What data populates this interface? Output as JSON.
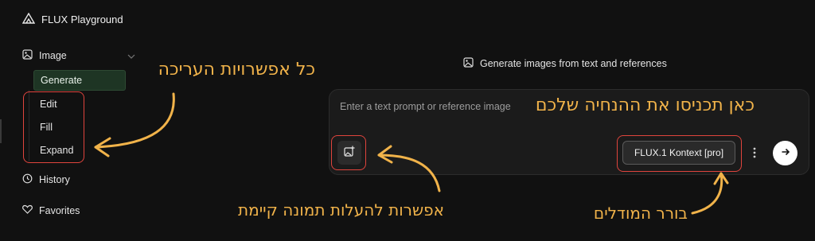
{
  "app": {
    "title": "FLUX Playground"
  },
  "sidebar": {
    "image_label": "Image",
    "sub_items": [
      {
        "label": "Generate",
        "active": true
      },
      {
        "label": "Edit"
      },
      {
        "label": "Fill"
      },
      {
        "label": "Expand"
      }
    ],
    "history_label": "History",
    "favorites_label": "Favorites"
  },
  "main": {
    "page_title": "Generate images from text and references",
    "prompt_placeholder": "Enter a text prompt or reference image",
    "model_label": "FLUX.1 Kontext [pro]"
  },
  "annotations": {
    "edit_options": "כל אפשרויות העריכה",
    "prompt_hint": "כאן תכניסו את ההנחיה שלכם",
    "upload_hint": "אפשרות להעלות תמונה קיימת",
    "model_hint": "בורר המודלים"
  },
  "colors": {
    "annotation": "#f1b34a",
    "highlight": "#e0443d",
    "active_item": "#1e3524",
    "background": "#111111"
  },
  "icons": {
    "logo": "flux-logo-icon",
    "image": "image-icon",
    "history": "clock-icon",
    "favorites": "heart-icon",
    "upload": "add-image-icon",
    "more": "more-vertical-icon",
    "send": "arrow-right-icon"
  }
}
